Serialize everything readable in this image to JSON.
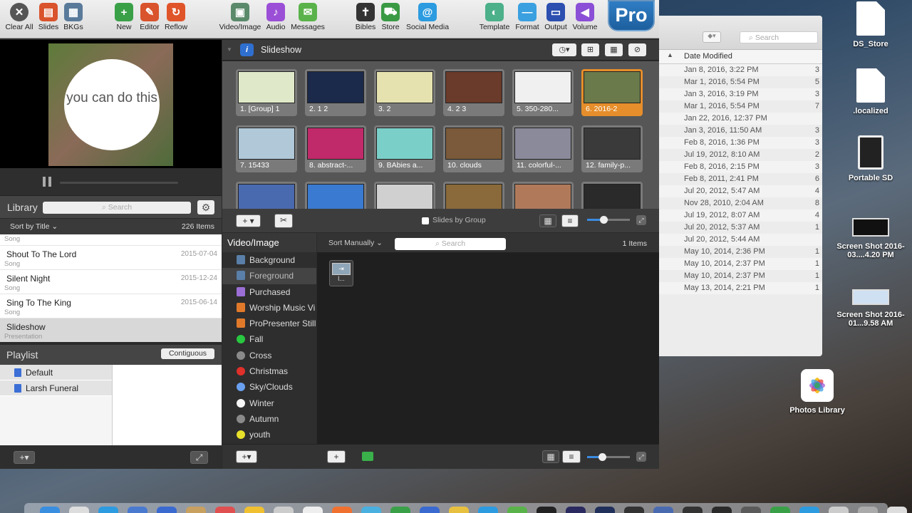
{
  "toolbar": {
    "buttons": [
      {
        "label": "Clear All",
        "icon": "clear-all-icon",
        "color": "#555555"
      },
      {
        "label": "Slides",
        "icon": "slides-icon",
        "color": "#d9532c"
      },
      {
        "label": "BKGs",
        "icon": "backgrounds-icon",
        "color": "#5a7a9a"
      },
      {
        "label": "New",
        "icon": "new-icon",
        "color": "#3aa048"
      },
      {
        "label": "Editor",
        "icon": "editor-icon",
        "color": "#d9532c"
      },
      {
        "label": "Reflow",
        "icon": "reflow-icon",
        "color": "#e0542a"
      },
      {
        "label": "Video/Image",
        "icon": "video-image-icon",
        "color": "#5a8a6a"
      },
      {
        "label": "Audio",
        "icon": "audio-icon",
        "color": "#9b4fd6"
      },
      {
        "label": "Messages",
        "icon": "messages-icon",
        "color": "#5ab34a"
      },
      {
        "label": "Bibles",
        "icon": "bibles-icon",
        "color": "#333333"
      },
      {
        "label": "Store",
        "icon": "store-icon",
        "color": "#3a9a44"
      },
      {
        "label": "Social Media",
        "icon": "social-media-icon",
        "color": "#2c9be0"
      },
      {
        "label": "Template",
        "icon": "template-icon",
        "color": "#4cb08a"
      },
      {
        "label": "Format",
        "icon": "format-icon",
        "color": "#3aa0e0"
      },
      {
        "label": "Output",
        "icon": "output-icon",
        "color": "#2c4fb0"
      },
      {
        "label": "Volume",
        "icon": "volume-icon",
        "color": "#8a4fd6"
      }
    ],
    "pro_badge": "Pro"
  },
  "preview": {
    "text": "you can do this"
  },
  "library": {
    "title": "Library",
    "search_placeholder": "Search",
    "sort_label": "Sort by Title",
    "count": "226 Items",
    "partial_type": "Song",
    "items": [
      {
        "name": "Shout To The Lord",
        "type": "Song",
        "date": "2015-07-04"
      },
      {
        "name": "Silent Night",
        "type": "Song",
        "date": "2015-12-24"
      },
      {
        "name": "Sing To The King",
        "type": "Song",
        "date": "2015-06-14"
      },
      {
        "name": "Slideshow",
        "type": "Presentation",
        "date": ""
      }
    ]
  },
  "playlist": {
    "title": "Playlist",
    "mode_button": "Contiguous",
    "items": [
      {
        "name": "Default"
      },
      {
        "name": "Larsh Funeral"
      }
    ]
  },
  "slideshow": {
    "title": "Slideshow",
    "slides_by_group": "Slides by Group",
    "slides": [
      {
        "label": "1. [Group] 1",
        "bg": "#dfe8c8"
      },
      {
        "label": "2. 1 2",
        "bg": "#1b2a4a"
      },
      {
        "label": "3. 2",
        "bg": "#e6e2b0"
      },
      {
        "label": "4. 2 3",
        "bg": "#6a3a2a"
      },
      {
        "label": "5. 350-280...",
        "bg": "#f0f0f0"
      },
      {
        "label": "6. 2016-2",
        "bg": "#6a7a4a"
      },
      {
        "label": "7. 15433",
        "bg": "#b0c8d8"
      },
      {
        "label": "8. abstract-...",
        "bg": "#c02a6a"
      },
      {
        "label": "9. BAbies a...",
        "bg": "#7ad0c8"
      },
      {
        "label": "10. clouds",
        "bg": "#7a5a3a"
      },
      {
        "label": "11. colorful-...",
        "bg": "#8a8a9a"
      },
      {
        "label": "12. family-p...",
        "bg": "#3a3a3a"
      },
      {
        "label": "",
        "bg": "#4a6ab0"
      },
      {
        "label": "",
        "bg": "#3a7ad0"
      },
      {
        "label": "",
        "bg": "#d0d0d0"
      },
      {
        "label": "",
        "bg": "#8a6a3a"
      },
      {
        "label": "",
        "bg": "#b07a5a"
      },
      {
        "label": "",
        "bg": "#2a2a2a"
      }
    ]
  },
  "media": {
    "section_title": "Video/Image",
    "sort_label": "Sort Manually",
    "search_placeholder": "Search",
    "count": "1 Items",
    "item_label": "l...",
    "categories": [
      {
        "name": "Background",
        "kind": "folder",
        "color": "#5a7fa8"
      },
      {
        "name": "Foreground",
        "kind": "folder",
        "color": "#5a7fa8"
      },
      {
        "name": "Purchased",
        "kind": "folder",
        "color": "#9b6fd6"
      },
      {
        "name": "Worship Music Vi",
        "kind": "folder",
        "color": "#e07a2a"
      },
      {
        "name": "ProPresenter Still",
        "kind": "folder",
        "color": "#e07a2a"
      },
      {
        "name": "Fall",
        "kind": "dot",
        "color": "#28c840"
      },
      {
        "name": "Cross",
        "kind": "dot",
        "color": "#8a8a8a"
      },
      {
        "name": "Christmas",
        "kind": "dot",
        "color": "#e0302a"
      },
      {
        "name": "Sky/Clouds",
        "kind": "dot",
        "color": "#6aa0f0"
      },
      {
        "name": "Winter",
        "kind": "dot",
        "color": "#f5f5f5"
      },
      {
        "name": "Autumn",
        "kind": "dot",
        "color": "#8a8a8a"
      },
      {
        "name": "youth",
        "kind": "dot",
        "color": "#e8e02a"
      }
    ]
  },
  "finder": {
    "search_placeholder": "Search",
    "column_header": "Date Modified",
    "rows": [
      {
        "date": "Jan 8, 2016, 3:22 PM",
        "size": "3"
      },
      {
        "date": "Mar 1, 2016, 5:54 PM",
        "size": "5"
      },
      {
        "date": "Jan 3, 2016, 3:19 PM",
        "size": "3"
      },
      {
        "date": "Mar 1, 2016, 5:54 PM",
        "size": "7"
      },
      {
        "date": "Jan 22, 2016, 12:37 PM",
        "size": ""
      },
      {
        "date": "Jan 3, 2016, 11:50 AM",
        "size": "3"
      },
      {
        "date": "Feb 8, 2016, 1:36 PM",
        "size": "3"
      },
      {
        "date": "Jul 19, 2012, 8:10 AM",
        "size": "2"
      },
      {
        "date": "Feb 8, 2016, 2:15 PM",
        "size": "3"
      },
      {
        "date": "Feb 8, 2011, 2:41 PM",
        "size": "6"
      },
      {
        "date": "Jul 20, 2012, 5:47 AM",
        "size": "4"
      },
      {
        "date": "Nov 28, 2010, 2:04 AM",
        "size": "8"
      },
      {
        "date": "Jul 19, 2012, 8:07 AM",
        "size": "4"
      },
      {
        "date": "Jul 20, 2012, 5:37 AM",
        "size": "1"
      },
      {
        "date": "Jul 20, 2012, 5:44 AM",
        "size": ""
      },
      {
        "date": "May 10, 2014, 2:36 PM",
        "size": "1"
      },
      {
        "date": "May 10, 2014, 2:37 PM",
        "size": "1"
      },
      {
        "date": "May 10, 2014, 2:37 PM",
        "size": "1"
      },
      {
        "date": "May 13, 2014, 2:21 PM",
        "size": "1"
      }
    ]
  },
  "desktop": {
    "icons": [
      {
        "label": "DS_Store",
        "kind": "doc"
      },
      {
        "label": ".localized",
        "kind": "doc"
      },
      {
        "label": "Portable SD",
        "kind": "sd"
      },
      {
        "label": "Screen Shot 2016-03....4.20 PM",
        "kind": "shot"
      },
      {
        "label": "Screen Shot 2016-01...9.58 AM",
        "kind": "shot2"
      },
      {
        "label": "Photos Library",
        "kind": "photos"
      }
    ]
  }
}
